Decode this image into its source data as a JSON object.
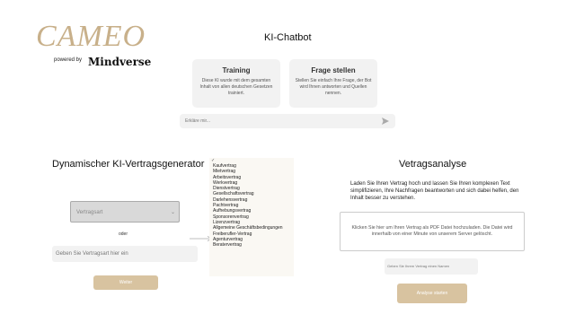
{
  "logo": {
    "text": "CAMEO",
    "powered_by": "powered by",
    "brand": "Mindverse"
  },
  "chatbot": {
    "title": "KI-Chatbot",
    "cards": [
      {
        "title": "Training",
        "text": "Diese KI wurde mit dem gesamten Inhalt von allen deutschen Gesetzen trainiert."
      },
      {
        "title": "Frage stellen",
        "text": "Stellen Sie einfach Ihre Frage, der Bot wird Ihnen antworten und Quellen nennen."
      }
    ],
    "input_placeholder": "Erkläre mir...",
    "send_icon": "send-icon"
  },
  "generator": {
    "title": "Dynamischer KI-Vertragsgenerator",
    "select_value": "Vertragsart",
    "or_label": "oder",
    "type_placeholder": "Geben Sie Vertragsart hier ein",
    "button_label": "Weiter",
    "dropdown_options": [
      "Kaufvertrag",
      "Mietvertrag",
      "Arbeitsvertrag",
      "Werkvertrag",
      "Dienstvertrag",
      "Gesellschaftsvertrag",
      "Darlehensvertrag",
      "Pachtvertrag",
      "Aufhebungsvertrag",
      "Sponsorenvertrag",
      "Lizenzvertrag",
      "Allgemeine Geschäftsbedingungen",
      "Freiberufler-Vertrag",
      "Agenturvertrag",
      "Beratervertrag"
    ]
  },
  "analysis": {
    "title": "Vetragsanalyse",
    "description": "Laden Sie Ihren Vertrag hoch und lassen Sie Ihren komplexen Text simplifizieren, Ihre Nachfragen beantworten und sich dabei helfen, den Inhalt besser zu verstehen.",
    "upload_text": "Klicken Sie hier um Ihren Vertrag als PDF Datei hochzuladen. Die Datei wird innerhalb von einer Minute von unserem Server gelöscht.",
    "name_placeholder": "Geben Sie Ihrem Vertrag einen Namen",
    "button_label": "Analyse starten"
  },
  "colors": {
    "accent": "#d8c3a0",
    "logo": "#c8b08a",
    "panel": "#f2f2f2"
  }
}
